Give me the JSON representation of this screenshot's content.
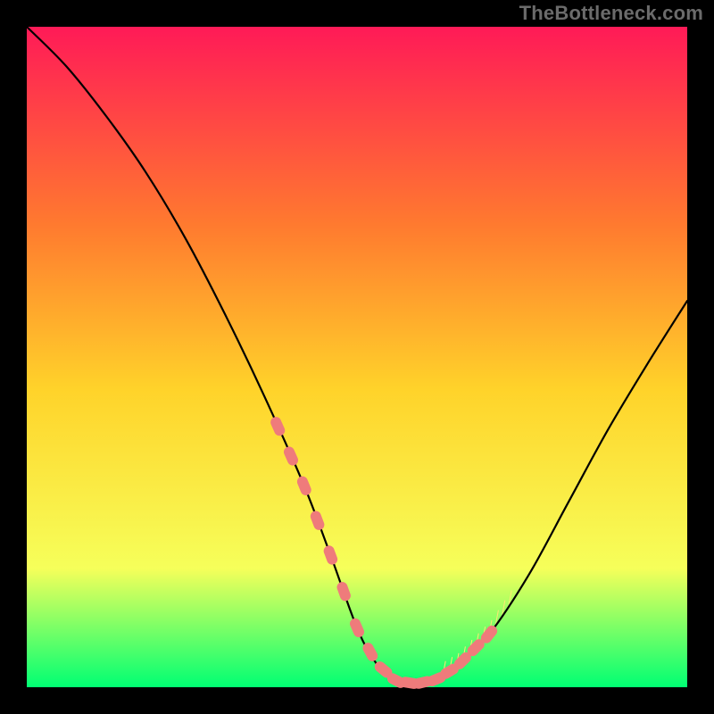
{
  "watermark": "TheBottleneck.com",
  "colors": {
    "gradient_top": "#ff1a57",
    "gradient_mid_upper": "#ff7a2f",
    "gradient_mid": "#ffd32a",
    "gradient_mid_lower": "#f6ff5a",
    "gradient_bottom": "#00ff73",
    "curve": "#000000",
    "marker_fill": "#ef7b7b",
    "marker_stroke": "#b84b4b",
    "tick": "#ffe873"
  },
  "chart_data": {
    "type": "line",
    "title": "",
    "xlabel": "",
    "ylabel": "",
    "xlim": [
      0,
      100
    ],
    "ylim": [
      0,
      100
    ],
    "series": [
      {
        "name": "bottleneck-curve",
        "x": [
          0,
          6,
          12,
          18,
          24,
          30,
          36,
          42,
          46,
          50,
          53,
          56,
          59,
          62,
          65,
          70,
          76,
          82,
          88,
          94,
          100
        ],
        "y": [
          100,
          94,
          86.5,
          78,
          68,
          56.5,
          44,
          30.5,
          20,
          9,
          3.5,
          1,
          0.5,
          1.2,
          3,
          8,
          17,
          28,
          39,
          49,
          58.5
        ]
      }
    ],
    "markers": {
      "name": "highlighted-points",
      "x": [
        38,
        40,
        42,
        44,
        46,
        48,
        50,
        52,
        54,
        56,
        58,
        60,
        62,
        64,
        66,
        68,
        70
      ],
      "y": [
        39,
        34,
        29,
        24,
        19,
        13,
        8,
        4.5,
        2,
        0.8,
        0.5,
        0.8,
        1.5,
        3,
        5,
        7.5,
        10
      ]
    },
    "ticks": {
      "x": [
        63,
        64,
        65,
        66,
        67,
        68,
        69,
        70,
        71,
        72,
        73
      ]
    }
  }
}
